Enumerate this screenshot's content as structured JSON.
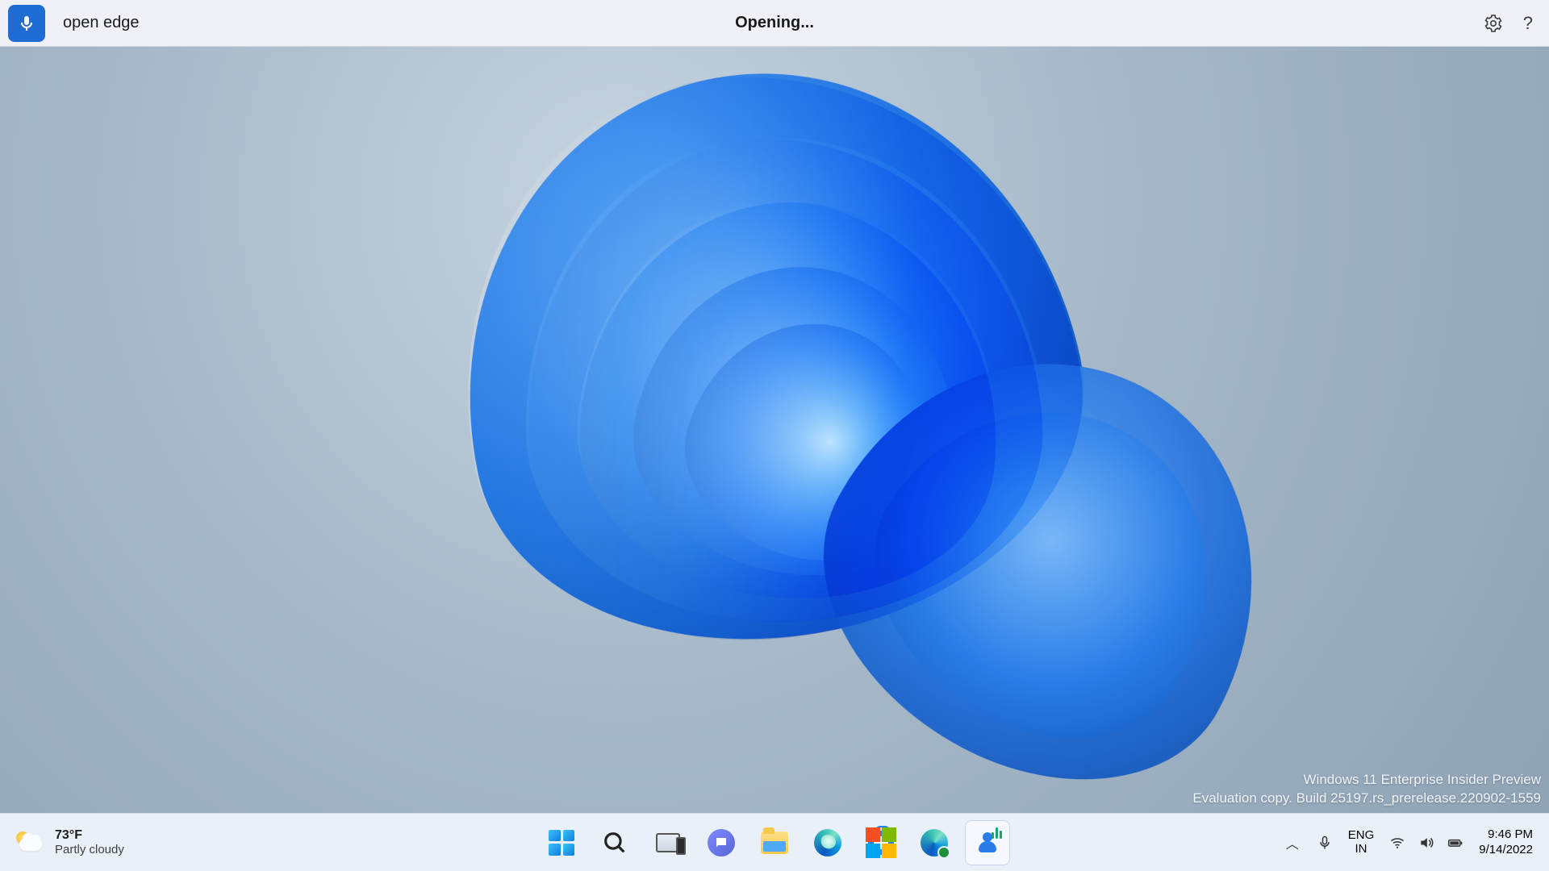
{
  "voice_bar": {
    "command_text": "open edge",
    "status_text": "Opening..."
  },
  "watermark": {
    "line1": "Windows 11 Enterprise Insider Preview",
    "line2": "Evaluation copy. Build 25197.rs_prerelease.220902-1559"
  },
  "weather": {
    "temperature": "73°F",
    "condition": "Partly cloudy"
  },
  "language": {
    "lang": "ENG",
    "region": "IN"
  },
  "clock": {
    "time": "9:46 PM",
    "date": "9/14/2022"
  }
}
